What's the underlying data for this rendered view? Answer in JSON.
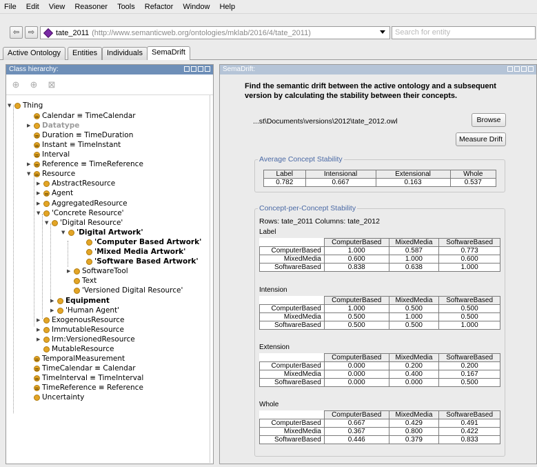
{
  "menu": [
    "File",
    "Edit",
    "View",
    "Reasoner",
    "Tools",
    "Refactor",
    "Window",
    "Help"
  ],
  "toolbar": {
    "ontology_name": "tate_2011",
    "ontology_uri": "(http://www.semanticweb.org/ontologies/mklab/2016/4/tate_2011)",
    "search_placeholder": "Search for entity",
    "back_icon": "left-arrow",
    "forward_icon": "right-arrow"
  },
  "tabs": [
    "Active Ontology",
    "Entities",
    "Individuals",
    "SemaDrift"
  ],
  "class_hierarchy": {
    "title": "Class hierarchy:",
    "nodes": [
      "Thing",
      "Calendar ≡ TimeCalendar",
      "Datatype",
      "Duration ≡ TimeDuration",
      "Instant ≡ TimeInstant",
      "Interval",
      "Reference ≡ TimeReference",
      "Resource",
      "AbstractResource",
      "Agent",
      "AggregatedResource",
      "'Concrete Resource'",
      "'Digital Resource'",
      "'Digital Artwork'",
      "'Computer Based Artwork'",
      "'Mixed Media Artwork'",
      "'Software Based Artwork'",
      "SoftwareTool",
      "Text",
      "'Versioned Digital Resource'",
      "Equipment",
      "'Human Agent'",
      "ExogenousResource",
      "ImmutableResource",
      "lrm:VersionedResource",
      "MutableResource",
      "TemporalMeasurement",
      "TimeCalendar ≡ Calendar",
      "TimeInterval ≡ TimeInterval",
      "TimeReference ≡ Reference",
      "Uncertainty"
    ]
  },
  "semadrift": {
    "title": "SemaDrift:",
    "intro": "Find the semantic drift between the active ontology and a subsequent version by calculating the stability between their concepts.",
    "path": "...st\\Documents\\versions\\2012\\tate_2012.owl",
    "browse_label": "Browse",
    "measure_label": "Measure Drift",
    "average": {
      "title": "Average Concept Stability",
      "headers": [
        "Label",
        "Intensional",
        "Extensional",
        "Whole"
      ],
      "values": [
        "0.782",
        "0.667",
        "0.163",
        "0.537"
      ]
    },
    "concept": {
      "title": "Concept-per-Concept Stability",
      "rows_cols": "Rows: tate_2011 Columns: tate_2012",
      "columns": [
        "ComputerBased",
        "MixedMedia",
        "SoftwareBased"
      ],
      "row_labels": [
        "ComputerBased",
        "MixedMedia",
        "SoftwareBased"
      ],
      "tables": [
        {
          "name": "Label",
          "rows": [
            [
              "1.000",
              "0.587",
              "0.773"
            ],
            [
              "0.600",
              "1.000",
              "0.600"
            ],
            [
              "0.838",
              "0.638",
              "1.000"
            ]
          ]
        },
        {
          "name": "Intension",
          "rows": [
            [
              "1.000",
              "0.500",
              "0.500"
            ],
            [
              "0.500",
              "1.000",
              "0.500"
            ],
            [
              "0.500",
              "0.500",
              "1.000"
            ]
          ]
        },
        {
          "name": "Extension",
          "rows": [
            [
              "0.000",
              "0.200",
              "0.200"
            ],
            [
              "0.000",
              "0.400",
              "0.167"
            ],
            [
              "0.000",
              "0.000",
              "0.500"
            ]
          ]
        },
        {
          "name": "Whole",
          "rows": [
            [
              "0.667",
              "0.429",
              "0.491"
            ],
            [
              "0.367",
              "0.800",
              "0.422"
            ],
            [
              "0.446",
              "0.379",
              "0.833"
            ]
          ]
        }
      ]
    }
  }
}
